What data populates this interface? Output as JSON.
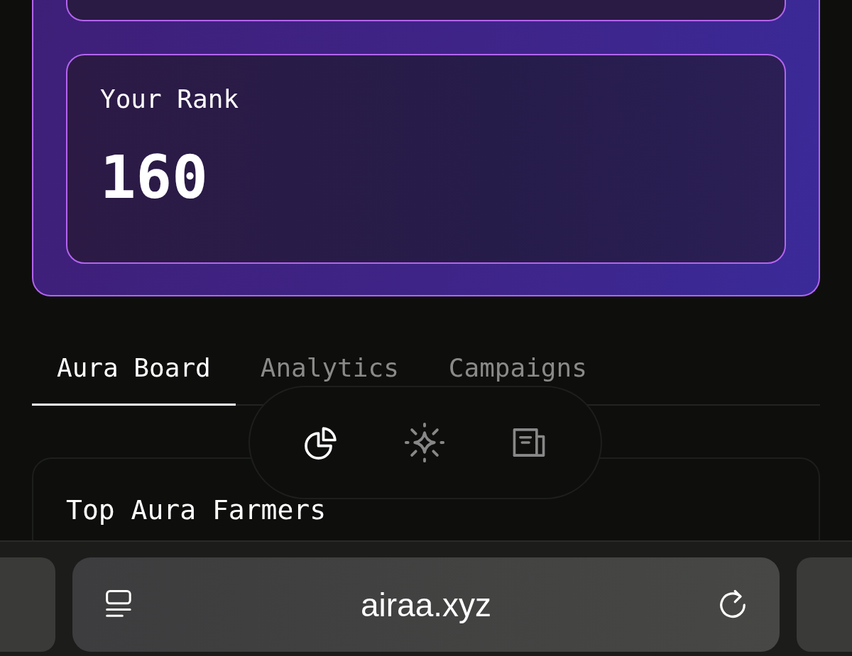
{
  "rank_card": {
    "label": "Your Rank",
    "value": "160"
  },
  "tabs": [
    {
      "label": "Aura Board",
      "selected": true
    },
    {
      "label": "Analytics",
      "selected": false
    },
    {
      "label": "Campaigns",
      "selected": false
    }
  ],
  "floating_nav": [
    {
      "kind": "chart",
      "selected": true
    },
    {
      "kind": "sparkle",
      "selected": false
    },
    {
      "kind": "news",
      "selected": false
    }
  ],
  "leaderboard": {
    "title": "Top Aura Farmers"
  },
  "browser_bar": {
    "url": "airaa.xyz"
  }
}
